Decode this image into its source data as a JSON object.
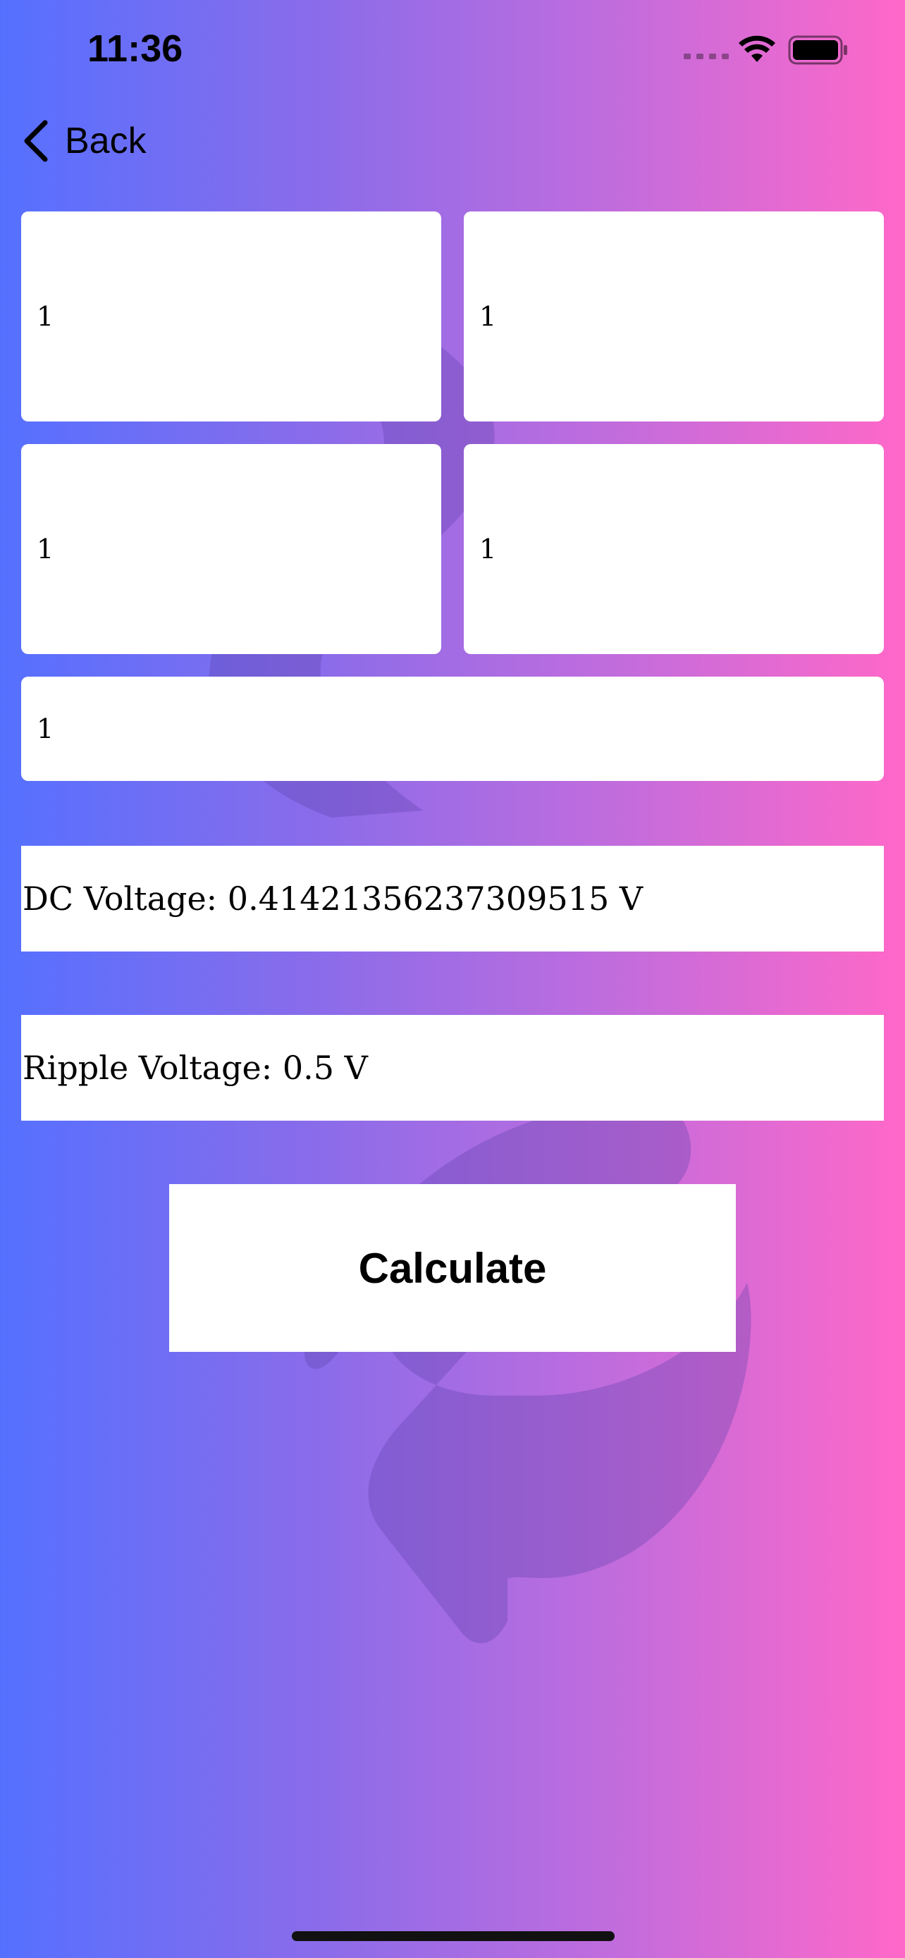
{
  "status_bar": {
    "time": "11:36",
    "icons": [
      "cellular-signal-icon",
      "wifi-icon",
      "battery-icon"
    ]
  },
  "nav": {
    "back_label": "Back",
    "back_icon": "chevron-left-icon"
  },
  "inputs": [
    {
      "value": "1"
    },
    {
      "value": "1"
    },
    {
      "value": "1"
    },
    {
      "value": "1"
    },
    {
      "value": "1"
    }
  ],
  "results": {
    "dc_voltage": "DC Voltage: 0.41421356237309515 V",
    "ripple_voltage": "Ripple Voltage: 0.5 V"
  },
  "actions": {
    "calculate_label": "Calculate"
  },
  "colors": {
    "gradient_left": "#5570ff",
    "gradient_right": "#ff68c8",
    "card": "#ffffff"
  }
}
